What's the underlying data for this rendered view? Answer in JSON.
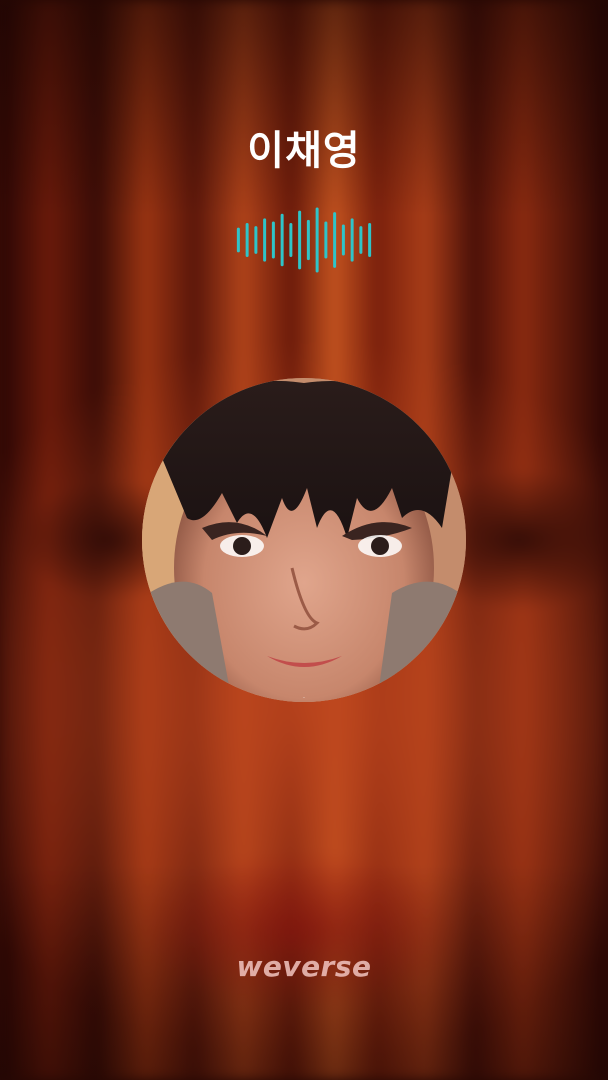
{
  "call": {
    "caller_name": "이채영",
    "status_icon": "voice-waveform-icon",
    "waveform_color": "#2fc4c8",
    "waveform_levels": [
      0.35,
      0.5,
      0.4,
      0.65,
      0.55,
      0.8,
      0.5,
      0.9,
      0.6,
      1.0,
      0.55,
      0.85,
      0.45,
      0.65,
      0.4,
      0.5
    ]
  },
  "avatar": {
    "icon": "profile-photo"
  },
  "branding": {
    "logo_text": "weverse"
  }
}
